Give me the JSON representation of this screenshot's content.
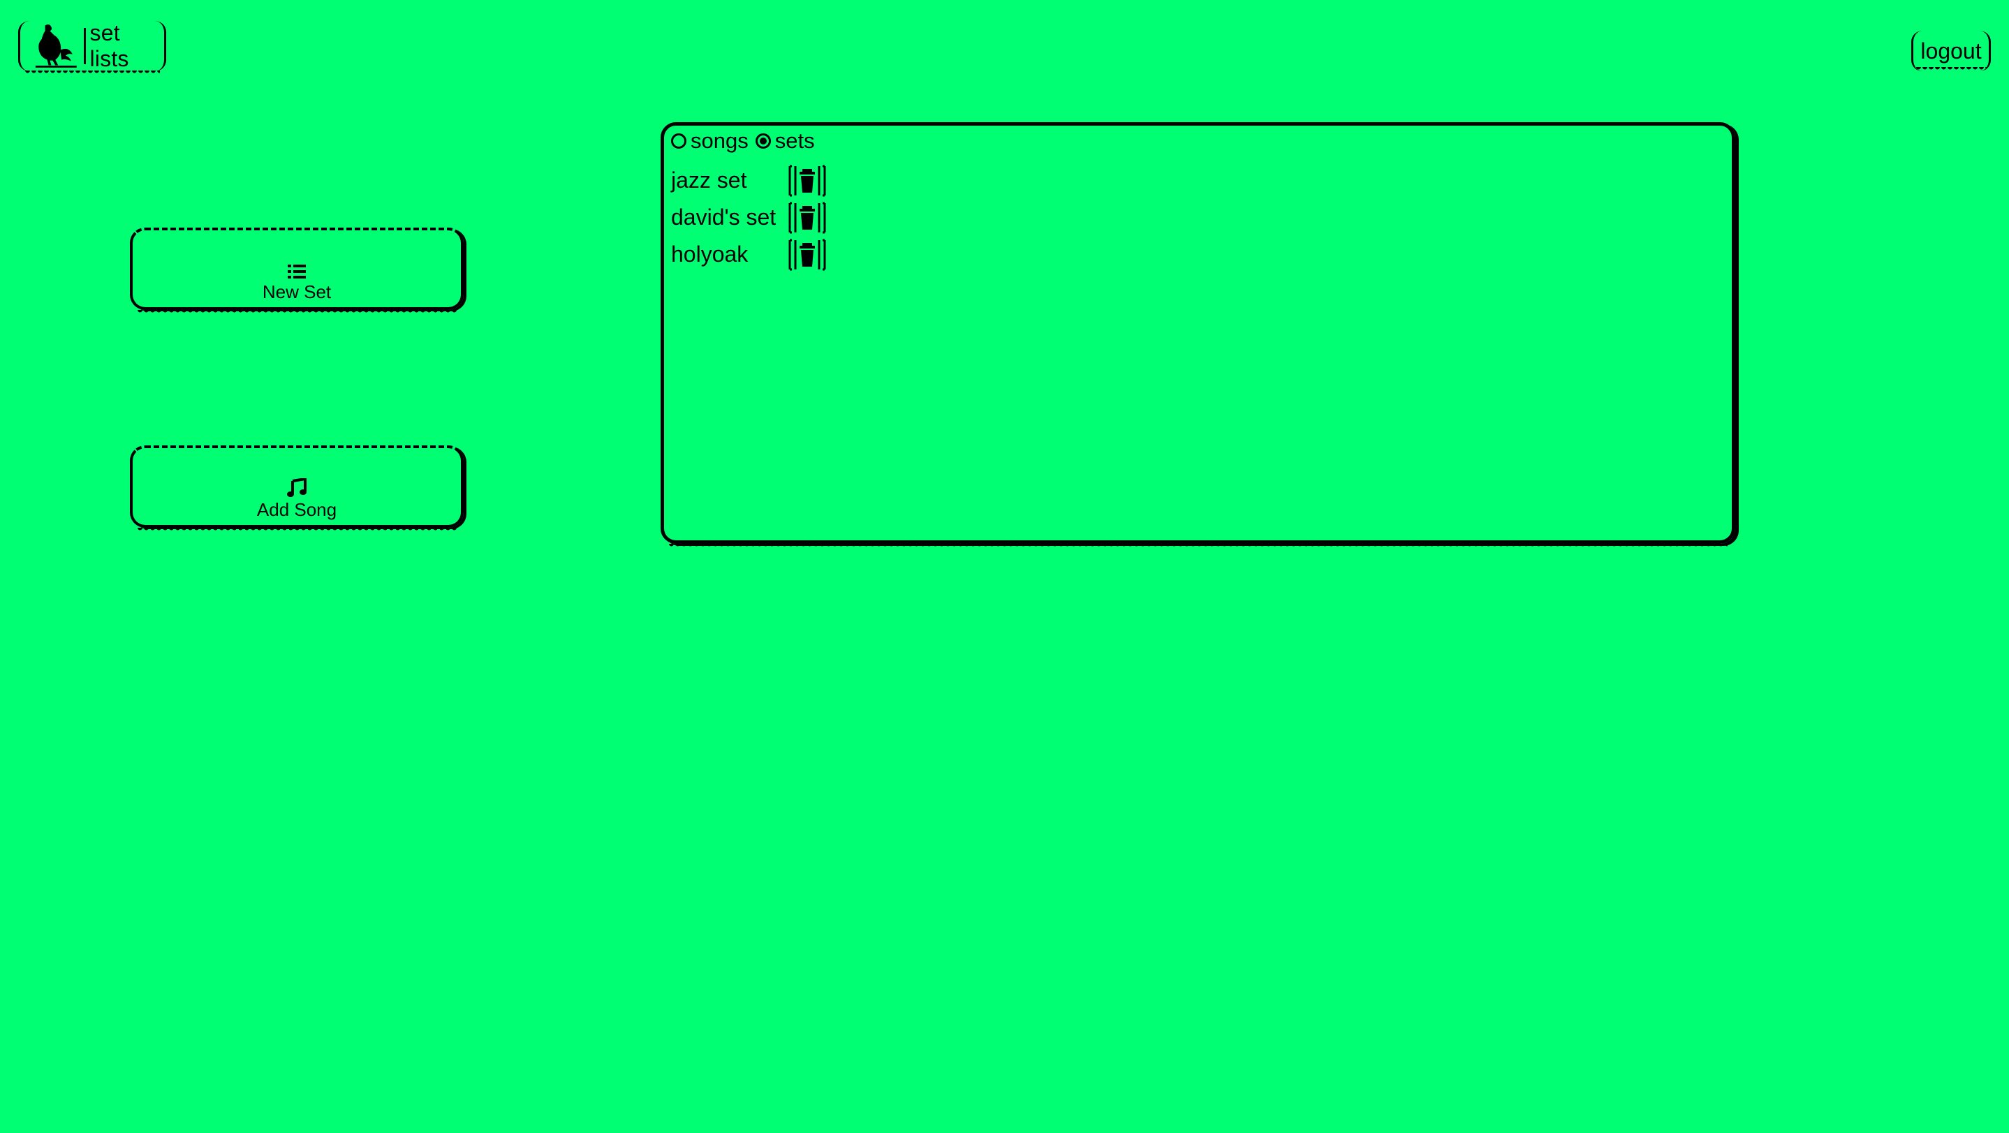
{
  "header": {
    "app_title": "set lists",
    "logout_label": "logout"
  },
  "actions": {
    "new_set_label": "New Set",
    "add_song_label": "Add Song"
  },
  "view_toggle": {
    "options": [
      {
        "label": "songs",
        "selected": false
      },
      {
        "label": "sets",
        "selected": true
      }
    ]
  },
  "sets": [
    {
      "name": "jazz set"
    },
    {
      "name": "david's set"
    },
    {
      "name": "holyoak"
    }
  ],
  "colors": {
    "background": "#00ff73",
    "ink": "#000000"
  },
  "icons": {
    "logo": "rooster-logo-icon",
    "new_set": "list-icon",
    "add_song": "music-note-icon",
    "delete": "trash-icon"
  }
}
